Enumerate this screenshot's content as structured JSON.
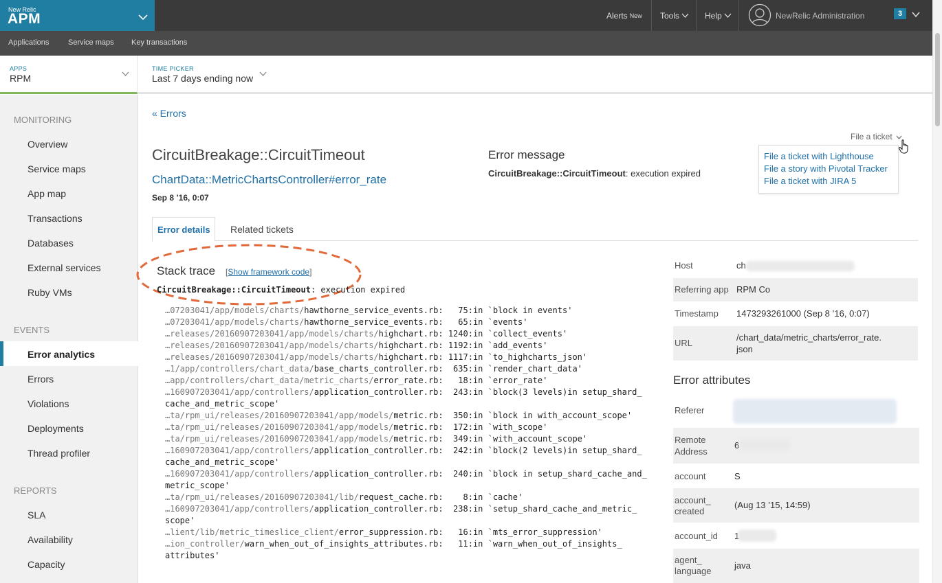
{
  "brand": {
    "small": "New Relic",
    "name": "APM"
  },
  "topnav": {
    "alerts": "Alerts",
    "alerts_sup": "New",
    "tools": "Tools",
    "help": "Help",
    "account": "NewRelic Administration",
    "badge": "3"
  },
  "subnav": [
    "Applications",
    "Service maps",
    "Key transactions"
  ],
  "pickers": {
    "apps_label": "APPS",
    "apps_value": "RPM",
    "time_label": "TIME PICKER",
    "time_value": "Last 7 days ending now"
  },
  "sidebar": {
    "monitoring": "MONITORING",
    "monitoring_items": [
      "Overview",
      "Service maps",
      "App map",
      "Transactions",
      "Databases",
      "External services",
      "Ruby VMs"
    ],
    "events": "EVENTS",
    "events_items": [
      "Error analytics",
      "Errors",
      "Violations",
      "Deployments",
      "Thread profiler"
    ],
    "reports": "REPORTS",
    "reports_items": [
      "SLA",
      "Availability",
      "Capacity"
    ]
  },
  "main": {
    "back": "« Errors",
    "title": "CircuitBreakage::CircuitTimeout",
    "transaction": "ChartData::MetricChartsController#error_rate",
    "date": "Sep 8 ’16, 0:07",
    "error_message_heading": "Error message",
    "error_class": "CircuitBreakage::CircuitTimeout",
    "error_text": ": execution expired",
    "file_ticket": "File a ticket",
    "ticket_options": [
      "File a ticket with Lighthouse",
      "File a story with Pivotal Tracker",
      "File a ticket with JIRA 5"
    ],
    "tabs": [
      "Error details",
      "Related tickets"
    ],
    "stack_heading": "Stack trace",
    "show_framework": "Show framework code",
    "stack_error_class": "CircuitBreakage::CircuitTimeout",
    "stack_error_text": ": execution expired",
    "trace": [
      [
        "…07203041/app/models/charts/",
        "hawthorne_service_events.rb",
        ":   75:in `block in events'"
      ],
      [
        "…07203041/app/models/charts/",
        "hawthorne_service_events.rb",
        ":   65:in `events'"
      ],
      [
        "…releases/20160907203041/app/models/charts/",
        "highchart.rb",
        ": 1240:in `collect_events'"
      ],
      [
        "…releases/20160907203041/app/models/charts/",
        "highchart.rb",
        ": 1192:in `add_events'"
      ],
      [
        "…releases/20160907203041/app/models/charts/",
        "highchart.rb",
        ": 1117:in `to_highcharts_json'"
      ],
      [
        "…1/app/controllers/chart_data/",
        "base_charts_controller.rb",
        ":  635:in `render_chart_data'"
      ],
      [
        "…app/controllers/chart_data/metric_charts/",
        "error_rate.rb",
        ":   18:in `error_rate'"
      ],
      [
        "…160907203041/app/controllers/",
        "application_controller.rb",
        ":  243:in `block(3 levels)in setup_shard_"
      ],
      [
        "",
        "cache_and_metric_scope'",
        ""
      ],
      [
        "…ta/rpm_ui/releases/20160907203041/app/models/",
        "metric.rb",
        ":  350:in `block in with_account_scope'"
      ],
      [
        "…ta/rpm_ui/releases/20160907203041/app/models/",
        "metric.rb",
        ":  172:in `with_scope'"
      ],
      [
        "…ta/rpm_ui/releases/20160907203041/app/models/",
        "metric.rb",
        ":  349:in `with_account_scope'"
      ],
      [
        "…160907203041/app/controllers/",
        "application_controller.rb",
        ":  242:in `block(2 levels)in setup_shard_"
      ],
      [
        "",
        "cache_and_metric_scope'",
        ""
      ],
      [
        "…160907203041/app/controllers/",
        "application_controller.rb",
        ":  240:in `block in setup_shard_cache_and_"
      ],
      [
        "",
        "metric_scope'",
        ""
      ],
      [
        "…ta/rpm_ui/releases/20160907203041/lib/",
        "request_cache.rb",
        ":    8:in `cache'"
      ],
      [
        "…160907203041/app/controllers/",
        "application_controller.rb",
        ":  238:in `setup_shard_cache_and_metric_"
      ],
      [
        "",
        "scope'",
        ""
      ],
      [
        "…lient/lib/metric_timeslice_client/",
        "error_suppression.rb",
        ":   16:in `mts_error_suppression'"
      ],
      [
        "…ion_controller/",
        "warn_when_out_of_insights_attributes.rb",
        ":   11:in `warn_when_out_of_insights_"
      ],
      [
        "",
        "attributes'",
        ""
      ]
    ]
  },
  "info": {
    "host_k": "Host",
    "host_v": "ch",
    "ref_k": "Referring app",
    "ref_v": "RPM Co",
    "ts_k": "Timestamp",
    "ts_v": "1473293261000 (Sep 8 ’16, 0:07)",
    "url_k": "URL",
    "url_v1": "/chart_data/metric_charts/error_rate.",
    "url_v2": "json",
    "attr_heading": "Error attributes",
    "referer_k": "Referer",
    "remote_k1": "Remote",
    "remote_k2": "Address",
    "remote_v": "6",
    "account_k": "account",
    "account_v": "S",
    "created_k1": "account_",
    "created_k2": "created",
    "created_v": "(Aug 13 ’15, 14:59)",
    "acctid_k": "account_id",
    "acctid_v": "1",
    "agent_k1": "agent_",
    "agent_k2": "language",
    "agent_v": "java"
  }
}
